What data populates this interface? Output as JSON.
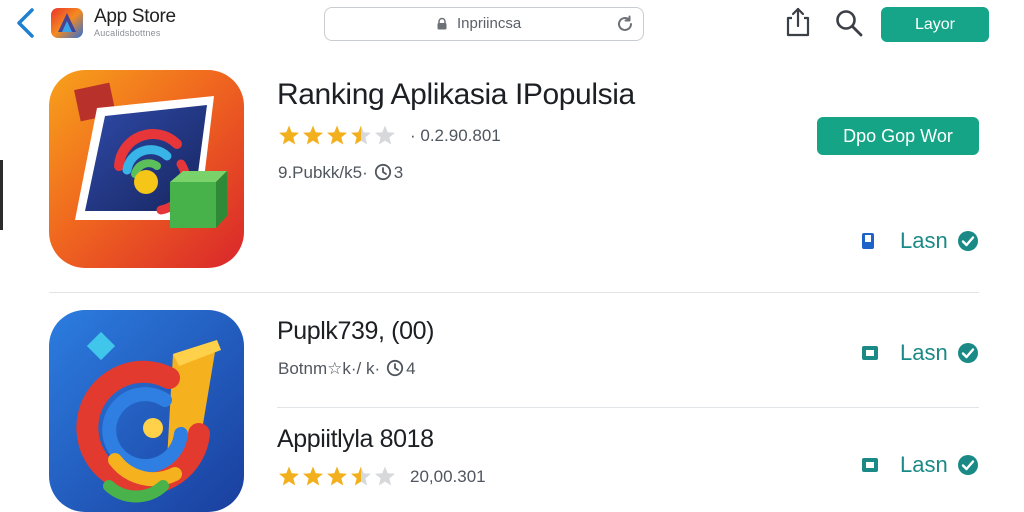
{
  "colors": {
    "accent": "#17a58a",
    "status": "#1b8a86",
    "star": "#f2b01e"
  },
  "header": {
    "back_icon": "chevron-left-icon",
    "title": "App Store",
    "subtitle": "Aucalidsbottnes",
    "search": {
      "text": "Inpriincsa"
    },
    "share_icon": "share-icon",
    "search_icon": "magnifier-icon",
    "button_label": "Layor"
  },
  "apps": [
    {
      "name": "Ranking Aplikasia IPopulsia",
      "rating": 3.5,
      "rating_text": "· 0.2.90.801",
      "meta_text": "9.Pubkk/k5·",
      "meta_count": "3",
      "action_label": "Dpo Gop Wor",
      "status_label": "Lasn",
      "status_icon": "phone-icon"
    },
    {
      "name": "Puplk739, (00)",
      "meta_text": "Botnm☆k·/ k·",
      "meta_count": "4",
      "status_label": "Lasn",
      "status_icon": "download-icon"
    },
    {
      "name": "Appiitlyla 8018",
      "rating": 3.5,
      "rating_text": "20,00.301",
      "status_label": "Lasn",
      "status_icon": "download-icon"
    }
  ]
}
